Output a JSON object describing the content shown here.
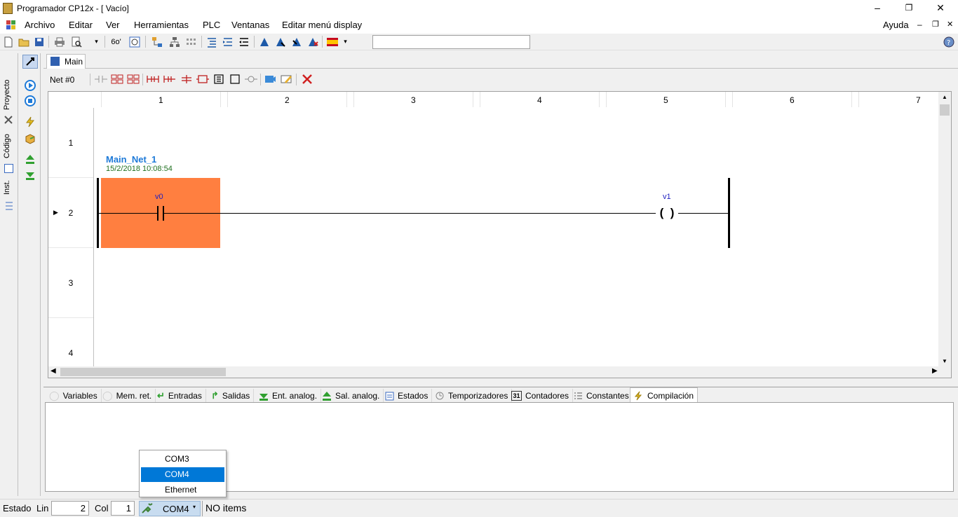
{
  "window": {
    "title": "Programador CP12x - [ Vacío]",
    "minimize_glyph": "–",
    "restore_glyph": "❐",
    "close_glyph": "✕"
  },
  "menu": {
    "items": [
      "Archivo",
      "Editar",
      "Ver",
      "Herramientas",
      "PLC",
      "Ventanas",
      "Editar menú display"
    ],
    "help": "Ayuda",
    "mdi_min": "–",
    "mdi_restore": "❐",
    "mdi_close": "✕"
  },
  "side": {
    "tabs": [
      "Proyecto",
      "Código",
      "Inst."
    ]
  },
  "editor": {
    "tab_label": "Main",
    "net_label": "Net #0",
    "columns": [
      "1",
      "2",
      "3",
      "4",
      "5",
      "6",
      "7"
    ],
    "rows": [
      "1",
      "2",
      "3",
      "4"
    ],
    "network": {
      "name": "Main_Net_1",
      "date": "15/2/2018 10:08:54",
      "contact_label": "v0",
      "coil_label": "v1",
      "coil_glyph": "(  )"
    },
    "accent_color": "#ff7f40"
  },
  "bottom_tabs": [
    {
      "label": "Variables",
      "icon": "bubble-icon"
    },
    {
      "label": "Mem. ret.",
      "icon": "bubble-icon"
    },
    {
      "label": "Entradas",
      "icon": "enter-arrow-icon"
    },
    {
      "label": "Salidas",
      "icon": "exit-arrow-icon"
    },
    {
      "label": "Ent. analog.",
      "icon": "download-icon"
    },
    {
      "label": "Sal. analog.",
      "icon": "upload-icon"
    },
    {
      "label": "Estados",
      "icon": "list-icon"
    },
    {
      "label": "Temporizadores",
      "icon": "timer-icon"
    },
    {
      "label": "Contadores",
      "icon": "counter-icon"
    },
    {
      "label": "Constantes",
      "icon": "constants-icon"
    },
    {
      "label": "Compilación",
      "icon": "lightning-icon"
    }
  ],
  "status": {
    "estado_label": "Estado",
    "lin_label": "Lin",
    "lin_value": "2",
    "col_label": "Col",
    "col_value": "1",
    "port_value": "COM4",
    "message": "NO items"
  },
  "port_dropdown": {
    "options": [
      "COM3",
      "COM4",
      "Ethernet"
    ],
    "selected": "COM4"
  }
}
